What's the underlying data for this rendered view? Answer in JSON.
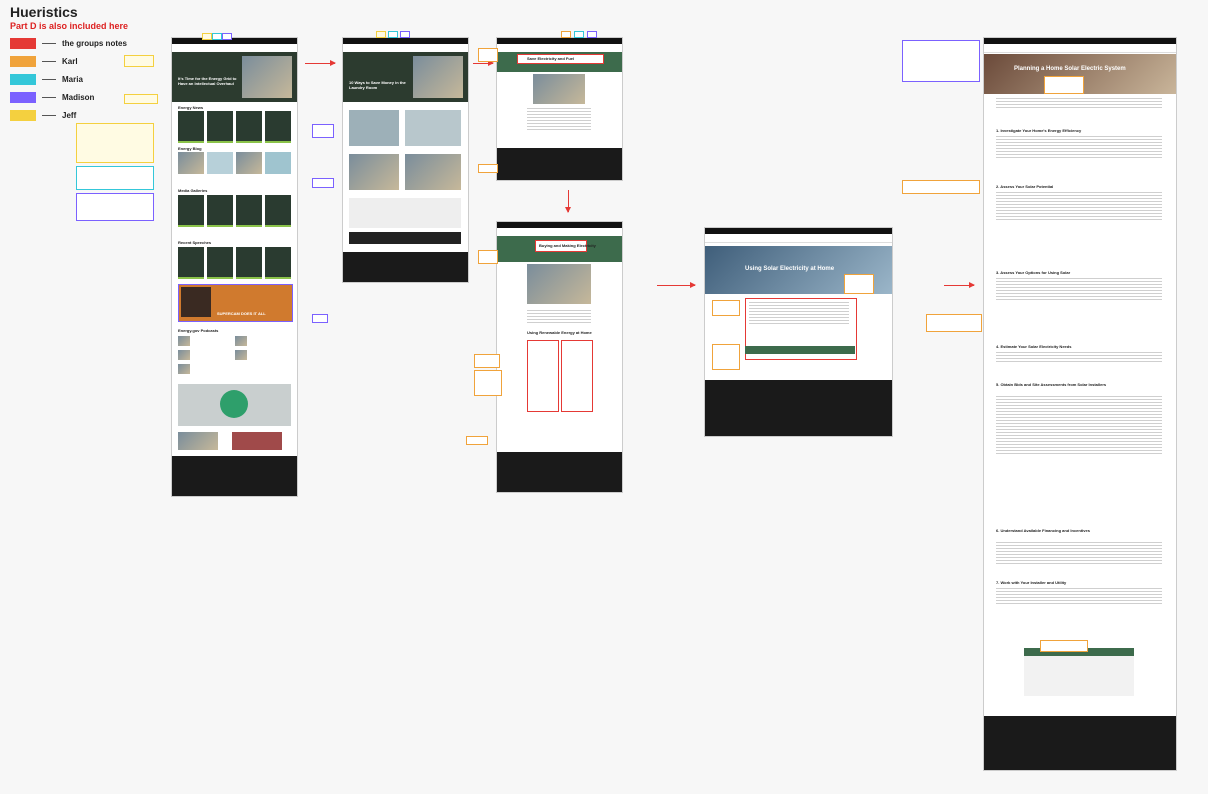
{
  "legend": {
    "title": "Hueristics",
    "subtitle": "Part D is also included here",
    "items": [
      {
        "label": "the groups notes",
        "color": "#e53935"
      },
      {
        "label": "Karl",
        "color": "#f0a33b"
      },
      {
        "label": "Maria",
        "color": "#34c7d9"
      },
      {
        "label": "Madison",
        "color": "#7b61ff"
      },
      {
        "label": "Jeff",
        "color": "#f4d03f"
      }
    ]
  },
  "frames": {
    "f1": {
      "hero_title": "It's Time for the Energy Grid to Have an Intellectual Overhaul",
      "sections": [
        "Energy News",
        "Energy Blog",
        "Media Galleries",
        "Recent Speeches",
        "SUPERCAM DOES IT ALL",
        "Energy.gov Podcasts"
      ]
    },
    "f2": {
      "hero_title": "10 Ways to Save Money in the Laundry Room"
    },
    "f3": {
      "hero_title": "Save Electricity and Fuel"
    },
    "f4": {
      "hero_title": "Buying and Making Electricity",
      "sub": "Using Renewable Energy at Home"
    },
    "f5": {
      "hero_title": "Using Solar Electricity at Home"
    },
    "f6": {
      "hero_title": "Planning a Home Solar Electric System",
      "sections": [
        "1. Investigate Your Home's Energy Efficiency",
        "2. Assess Your Solar Potential",
        "3. Assess Your Options for Using Solar",
        "4. Estimate Your Solar Electricity Needs",
        "5. Obtain Bids and Site Assessments from Solar Installers",
        "6. Understand Available Financing and Incentives",
        "7. Work with Your Installer and Utility"
      ]
    }
  }
}
